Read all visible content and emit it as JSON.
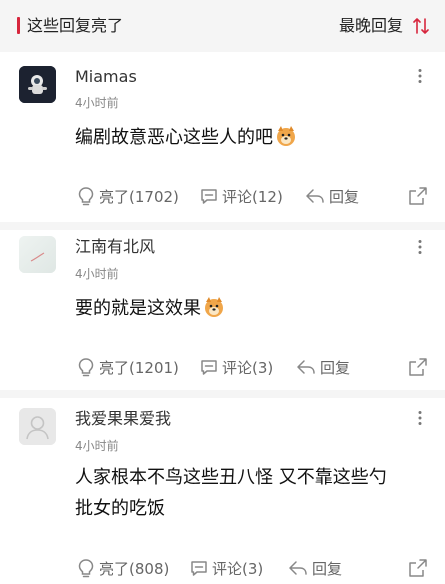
{
  "header": {
    "section_title": "这些回复亮了",
    "sort_label": "最晚回复",
    "sort_icon": "sort-arrows-icon",
    "accent_color": "#d7263d"
  },
  "comments": [
    {
      "username": "Miamas",
      "time": "4小时前",
      "content": "编剧故意恶心这些人的吧",
      "emoji": "doge-emoji",
      "likes_label": "亮了(1702)",
      "comments_label": "评论(12)",
      "reply_label": "回复"
    },
    {
      "username": "江南有北风",
      "time": "4小时前",
      "content": "要的就是这效果",
      "emoji": "doge-emoji",
      "likes_label": "亮了(1201)",
      "comments_label": "评论(3)",
      "reply_label": "回复"
    },
    {
      "username": "我爱果果爱我",
      "time": "4小时前",
      "content_line1": "人家根本不鸟这些丑八怪 又不靠这些勺",
      "content_line2": "批女的吃饭",
      "likes_label": "亮了(808)",
      "comments_label": "评论(3)",
      "reply_label": "回复"
    }
  ]
}
